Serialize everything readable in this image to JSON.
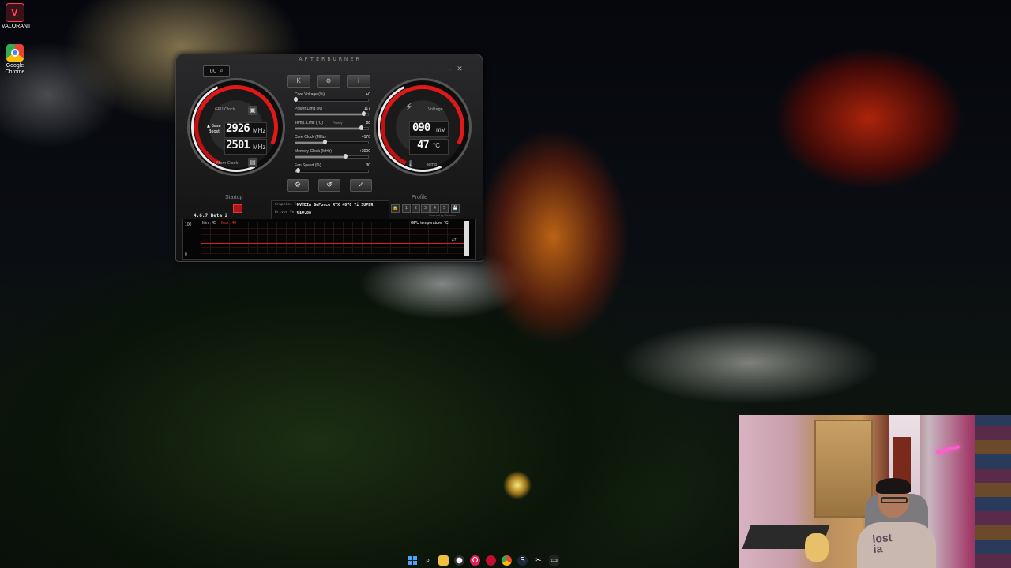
{
  "desktop": {
    "icons": [
      {
        "label": "VALORANT",
        "icon": "valorant-icon"
      },
      {
        "label": "Google Chrome",
        "icon": "chrome-icon"
      }
    ]
  },
  "afterburner": {
    "brand": "AFTERBURNER",
    "oc_label": "OC",
    "left_gauge": {
      "label_top": "GPU Clock",
      "base_label": "Base",
      "boost_label": "Boost",
      "value_base": "2926",
      "value_boost": "2501",
      "unit": "MHz",
      "label_bottom": "Mem Clock",
      "ticks": [
        "1250",
        "1500",
        "1750",
        "2000",
        "2250",
        "2500",
        "2750",
        "3000",
        "3250",
        "3500",
        "3750",
        "1000",
        "750",
        "500",
        "250"
      ]
    },
    "right_gauge": {
      "label_top": "Voltage",
      "value_voltage": "090",
      "voltage_unit": "mV",
      "value_temp": "47",
      "temp_unit": "°C",
      "label_bottom": "Temp.",
      "ticks": [
        "75",
        "100",
        "125",
        "150",
        "175",
        "194",
        "32°F",
        "50",
        "25"
      ]
    },
    "toolbar": {
      "k_boost": "K",
      "scan": "⚙",
      "info": "i"
    },
    "sliders": [
      {
        "name": "Core Voltage (%)",
        "value": "+0",
        "fill": 0.02
      },
      {
        "name": "Power Limit (%)",
        "value": "117",
        "fill": 0.95
      },
      {
        "name": "Temp. Limit (°C)",
        "value": "88",
        "fill": 0.92,
        "tag": "Priority"
      },
      {
        "name": "Core Clock (MHz)",
        "value": "+170",
        "fill": 0.42
      },
      {
        "name": "Memory Clock (MHz)",
        "value": "+2000",
        "fill": 0.7
      },
      {
        "name": "Fan Speed (%)",
        "value": "30",
        "fill": 0.05
      }
    ],
    "bottom_buttons": {
      "settings": "⚙",
      "reset": "↺",
      "apply": "✓"
    },
    "startup_label": "Startup",
    "profile_label": "Profile",
    "profile_slots": [
      "1",
      "2",
      "3",
      "4",
      "5"
    ],
    "graphics_card_label": "Graphics Card:",
    "graphics_card_value": "NVIDIA GeForce RTX 4070 Ti SUPER",
    "driver_label": "Driver Version:",
    "driver_value": "610.88",
    "powered_by": "Powered by Rivatuner",
    "version": "4.6.7 Beta 2",
    "monitor": {
      "min_label": "Min : 45",
      "max_label": "Max : 48",
      "title": "GPU temperature, °C",
      "y_top": "100",
      "y_bottom": "0",
      "current": "47"
    }
  },
  "taskbar": {
    "items": [
      "start",
      "search",
      "files",
      "obs",
      "opera",
      "record",
      "chrome",
      "steam",
      "capcut",
      "terminal"
    ]
  }
}
